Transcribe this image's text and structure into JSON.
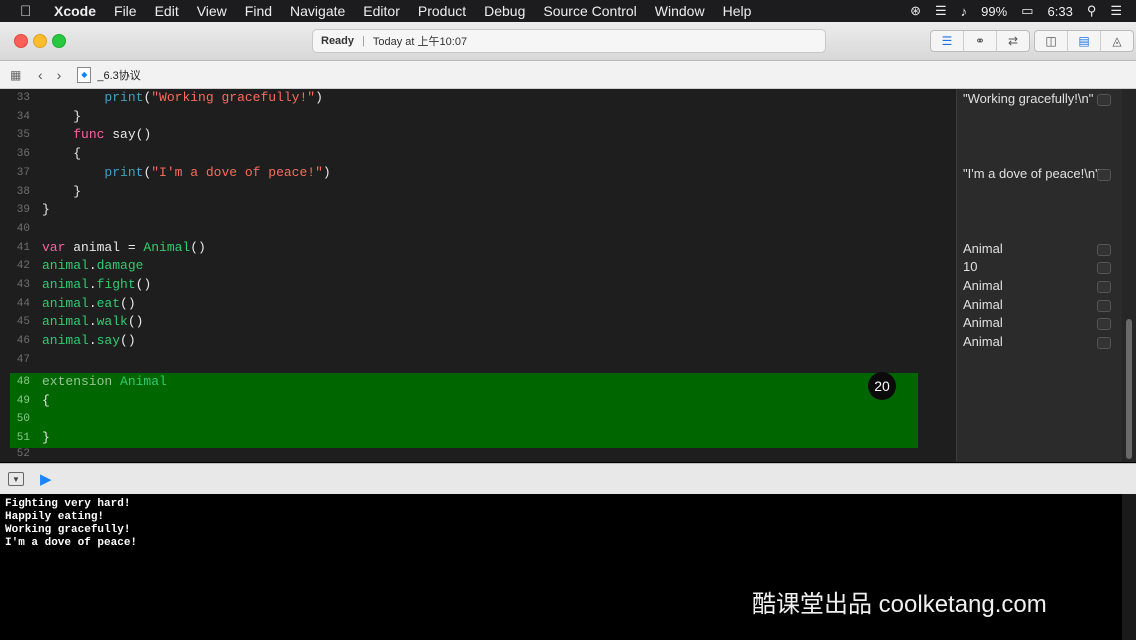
{
  "menubar": {
    "app": "Xcode",
    "items": [
      "File",
      "Edit",
      "View",
      "Find",
      "Navigate",
      "Editor",
      "Product",
      "Debug",
      "Source Control",
      "Window",
      "Help"
    ],
    "battery": "99%",
    "time": "6:33"
  },
  "toolbar": {
    "status": "Ready",
    "activity": "Today at 上午10:07"
  },
  "jumpbar": {
    "file": "_6.3协议"
  },
  "code_lines": [
    {
      "num": "33",
      "parts": [
        [
          "plain",
          "        "
        ],
        [
          "fn",
          "print"
        ],
        [
          "plain",
          "("
        ],
        [
          "str",
          "\"Working gracefully!\""
        ],
        [
          "plain",
          ")"
        ]
      ]
    },
    {
      "num": "34",
      "parts": [
        [
          "plain",
          "    }"
        ]
      ]
    },
    {
      "num": "35",
      "parts": [
        [
          "plain",
          "    "
        ],
        [
          "kw",
          "func"
        ],
        [
          "plain",
          " say()"
        ]
      ]
    },
    {
      "num": "36",
      "parts": [
        [
          "plain",
          "    {"
        ]
      ]
    },
    {
      "num": "37",
      "parts": [
        [
          "plain",
          "        "
        ],
        [
          "fn",
          "print"
        ],
        [
          "plain",
          "("
        ],
        [
          "str",
          "\"I'm a dove of peace!\""
        ],
        [
          "plain",
          ")"
        ]
      ]
    },
    {
      "num": "38",
      "parts": [
        [
          "plain",
          "    }"
        ]
      ]
    },
    {
      "num": "39",
      "parts": [
        [
          "plain",
          "}"
        ]
      ]
    },
    {
      "num": "40",
      "parts": [
        [
          "plain",
          ""
        ]
      ]
    },
    {
      "num": "41",
      "parts": [
        [
          "kw",
          "var"
        ],
        [
          "plain",
          " animal = "
        ],
        [
          "green",
          "Animal"
        ],
        [
          "plain",
          "()"
        ]
      ]
    },
    {
      "num": "42",
      "parts": [
        [
          "green",
          "animal"
        ],
        [
          "plain",
          "."
        ],
        [
          "green",
          "damage"
        ]
      ]
    },
    {
      "num": "43",
      "parts": [
        [
          "green",
          "animal"
        ],
        [
          "plain",
          "."
        ],
        [
          "green",
          "fight"
        ],
        [
          "plain",
          "()"
        ]
      ]
    },
    {
      "num": "44",
      "parts": [
        [
          "green",
          "animal"
        ],
        [
          "plain",
          "."
        ],
        [
          "green",
          "eat"
        ],
        [
          "plain",
          "()"
        ]
      ]
    },
    {
      "num": "45",
      "parts": [
        [
          "green",
          "animal"
        ],
        [
          "plain",
          "."
        ],
        [
          "green",
          "walk"
        ],
        [
          "plain",
          "()"
        ]
      ]
    },
    {
      "num": "46",
      "parts": [
        [
          "green",
          "animal"
        ],
        [
          "plain",
          "."
        ],
        [
          "green",
          "say"
        ],
        [
          "plain",
          "()"
        ]
      ]
    },
    {
      "num": "47",
      "parts": [
        [
          "plain",
          ""
        ]
      ]
    }
  ],
  "highlight_lines": [
    {
      "num": "48",
      "parts": [
        [
          "dim",
          "extension "
        ],
        [
          "green",
          "Animal"
        ]
      ]
    },
    {
      "num": "49",
      "parts": [
        [
          "plain",
          "{"
        ]
      ]
    },
    {
      "num": "50",
      "parts": [
        [
          "plain",
          ""
        ]
      ]
    },
    {
      "num": "51",
      "parts": [
        [
          "plain",
          "}"
        ]
      ]
    }
  ],
  "last_line": {
    "num": "52"
  },
  "badge": "20",
  "results": [
    {
      "line": 0,
      "text": "\"Working gracefully!\\n\""
    },
    {
      "line": 4,
      "text": "\"I'm a dove of peace!\\n\""
    },
    {
      "line": 8,
      "text": "Animal"
    },
    {
      "line": 9,
      "text": "10"
    },
    {
      "line": 10,
      "text": "Animal"
    },
    {
      "line": 11,
      "text": "Animal"
    },
    {
      "line": 12,
      "text": "Animal"
    },
    {
      "line": 13,
      "text": "Animal"
    }
  ],
  "console": [
    "Fighting very hard!",
    "Happily eating!",
    "Working gracefully!",
    "I'm a dove of peace!"
  ],
  "watermark": "酷课堂出品 coolketang.com"
}
